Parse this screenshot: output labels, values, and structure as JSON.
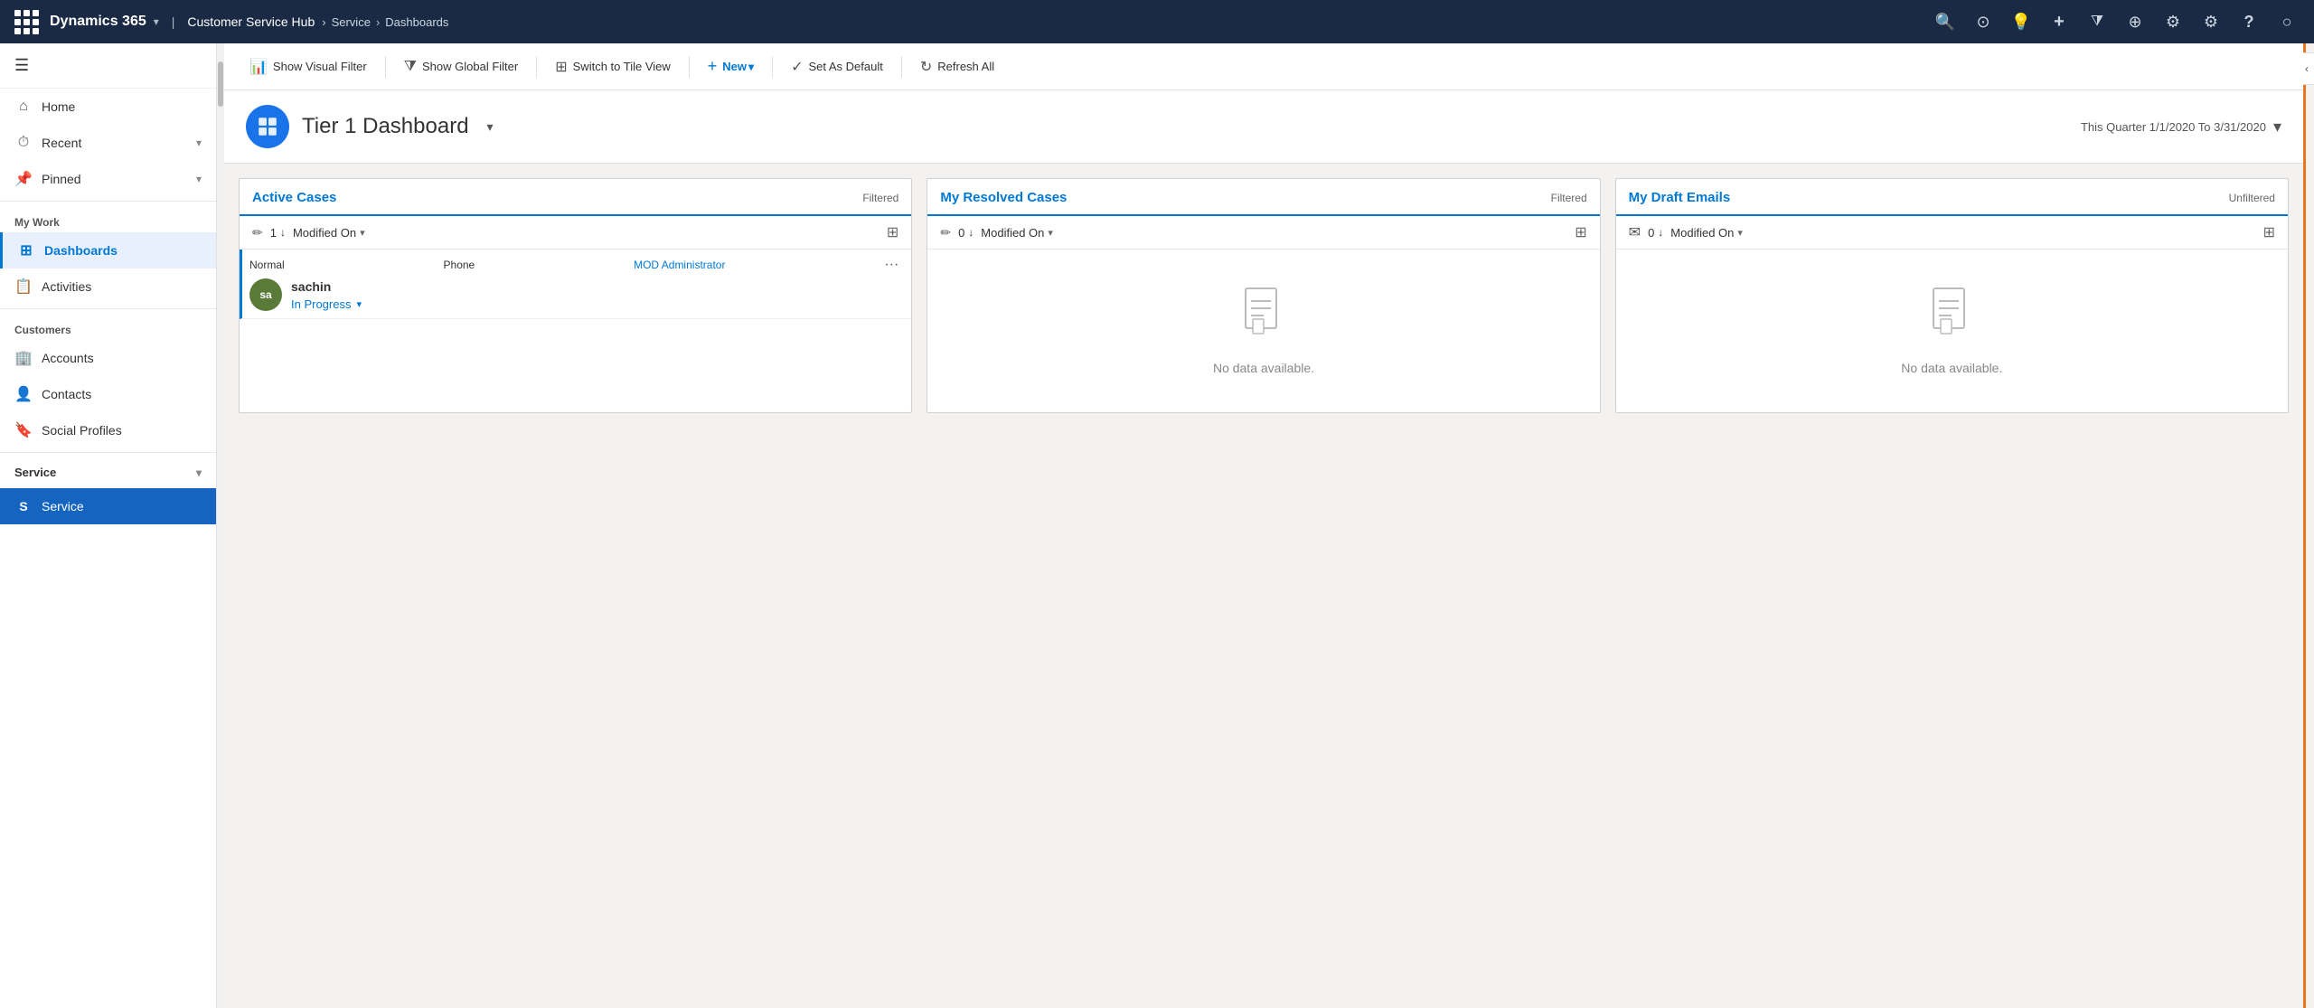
{
  "topNav": {
    "appName": "Dynamics 365",
    "appChevron": "▾",
    "hubName": "Customer Service Hub",
    "breadcrumb": {
      "items": [
        "Service",
        "Dashboards"
      ]
    },
    "icons": {
      "waffle": "⊞",
      "search": "🔍",
      "recent": "⏱",
      "lightbulb": "💡",
      "plus": "+",
      "filter": "⧩",
      "circleplus": "⊕",
      "settings_small": "⚙",
      "settings": "⚙",
      "help": "?",
      "user": "👤"
    }
  },
  "toolbar": {
    "showVisualFilter": "Show Visual Filter",
    "showGlobalFilter": "Show Global Filter",
    "switchToTileView": "Switch to Tile View",
    "new": "New",
    "setAsDefault": "Set As Default",
    "refreshAll": "Refresh All",
    "icons": {
      "chart": "📊",
      "filter": "⧩",
      "grid": "⊞",
      "plus": "+",
      "check": "✓",
      "refresh": "↻"
    }
  },
  "sidebar": {
    "menuIcon": "☰",
    "home": "Home",
    "recent": "Recent",
    "pinned": "Pinned",
    "sections": {
      "myWork": {
        "label": "My Work",
        "items": [
          {
            "id": "dashboards",
            "label": "Dashboards",
            "icon": "⊞",
            "active": true
          },
          {
            "id": "activities",
            "label": "Activities",
            "icon": "📋",
            "active": false
          }
        ]
      },
      "customers": {
        "label": "Customers",
        "items": [
          {
            "id": "accounts",
            "label": "Accounts",
            "icon": "🏢",
            "active": false
          },
          {
            "id": "contacts",
            "label": "Contacts",
            "icon": "👤",
            "active": false
          },
          {
            "id": "socialprofiles",
            "label": "Social Profiles",
            "icon": "🔖",
            "active": false
          }
        ]
      },
      "service": {
        "label": "Service",
        "items": [
          {
            "id": "service",
            "label": "Service",
            "icon": "S",
            "active": false
          }
        ]
      }
    }
  },
  "dashboard": {
    "icon": "⊞",
    "title": "Tier 1 Dashboard",
    "titleChevron": "▾",
    "dateFilter": "This Quarter 1/1/2020 To 3/31/2020",
    "dateChevron": "▾",
    "cards": [
      {
        "id": "active-cases",
        "title": "Active Cases",
        "filterBadge": "Filtered",
        "count": "1",
        "sortField": "Modified On",
        "sortChevron": "▾",
        "viewIcon": "⊞",
        "empty": false,
        "rows": [
          {
            "type": "Normal",
            "channel": "Phone",
            "owner": "MOD Administrator",
            "avatarInitials": "sa",
            "avatarColor": "#5a7a3a",
            "name": "sachin",
            "status": "In Progress",
            "statusChevron": "▾"
          }
        ]
      },
      {
        "id": "my-resolved-cases",
        "title": "My Resolved Cases",
        "filterBadge": "Filtered",
        "count": "0",
        "sortField": "Modified On",
        "sortChevron": "▾",
        "viewIcon": "⊞",
        "empty": true,
        "emptyText": "No data available.",
        "rows": []
      },
      {
        "id": "my-draft-emails",
        "title": "My Draft Emails",
        "filterBadge": "Unfiltered",
        "count": "0",
        "sortField": "Modified On",
        "sortChevron": "▾",
        "viewIcon": "⊞",
        "empty": true,
        "emptyText": "No data available.",
        "rows": [],
        "iconType": "mail"
      }
    ]
  }
}
